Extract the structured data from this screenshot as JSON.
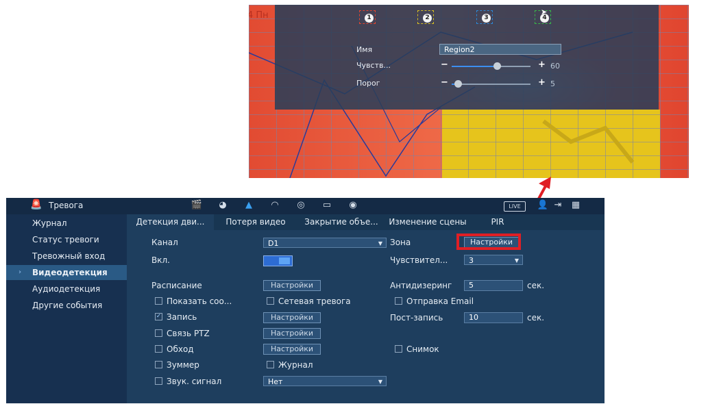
{
  "zone_config": {
    "day_label": "4 Пн",
    "region_tabs": [
      "1",
      "2",
      "3",
      "4"
    ],
    "region_colors": [
      "#e8442c",
      "#d8c020",
      "#2a88d8",
      "#38b848"
    ],
    "name_label": "Имя",
    "name_value": "Region2",
    "sensitivity_label": "Чувств...",
    "sensitivity_value": "60",
    "threshold_label": "Порог",
    "threshold_value": "5",
    "minus": "−",
    "plus": "+"
  },
  "topbar": {
    "title": "Тревога",
    "live_label": "LIVE",
    "icons": [
      "clapper-icon",
      "brain-icon",
      "alarm-icon",
      "gauge-icon",
      "record-icon",
      "monitor-icon",
      "audio-icon"
    ]
  },
  "sidebar": {
    "items": [
      {
        "label": "Журнал"
      },
      {
        "label": "Статус тревоги"
      },
      {
        "label": "Тревожный вход"
      },
      {
        "label": "Видеодетекция"
      },
      {
        "label": "Аудиодетекция"
      },
      {
        "label": "Другие события"
      }
    ]
  },
  "tabs": [
    {
      "label": "Детекция дви..."
    },
    {
      "label": "Потеря видео"
    },
    {
      "label": "Закрытие объе..."
    },
    {
      "label": "Изменение сцены"
    },
    {
      "label": "PIR"
    }
  ],
  "form": {
    "channel_label": "Канал",
    "channel_value": "D1",
    "enable_label": "Вкл.",
    "zone_label": "Зона",
    "zone_button": "Настройки",
    "sensitivity_label": "Чувствител...",
    "sensitivity_value": "3",
    "schedule_label": "Расписание",
    "schedule_button": "Настройки",
    "antidither_label": "Антидизеринг",
    "antidither_value": "5",
    "antidither_unit": "сек.",
    "show_message_label": "Показать соо...",
    "network_alarm_label": "Сетевая тревога",
    "send_email_label": "Отправка Email",
    "record_label": "Запись",
    "record_button": "Настройки",
    "post_record_label": "Пост-запись",
    "post_record_value": "10",
    "post_record_unit": "сек.",
    "ptz_label": "Связь PTZ",
    "ptz_button": "Настройки",
    "tour_label": "Обход",
    "tour_button": "Настройки",
    "snapshot_label": "Снимок",
    "buzzer_label": "Зуммер",
    "log_label": "Журнал",
    "sound_label": "Звук. сигнал",
    "sound_value": "Нет",
    "checkmark": "✓"
  }
}
